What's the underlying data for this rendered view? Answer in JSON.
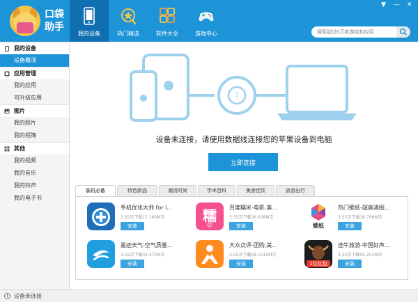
{
  "brand": {
    "line1": "口袋",
    "line2": "助手"
  },
  "nav": [
    {
      "label": "我的设备",
      "icon": "phone-icon"
    },
    {
      "label": "热门精选",
      "icon": "star-icon"
    },
    {
      "label": "软件大全",
      "icon": "apps-grid-icon"
    },
    {
      "label": "游戏中心",
      "icon": "gamepad-icon"
    }
  ],
  "window": {
    "menu": "▼",
    "minimize": "—",
    "close": "✕"
  },
  "search": {
    "placeholder": "搜索超过6万款游戏和应用"
  },
  "sidebar": [
    {
      "title": "我的设备",
      "icon": "device-icon",
      "items": [
        "设备概况"
      ]
    },
    {
      "title": "应用管理",
      "icon": "app-manage-icon",
      "items": [
        "我的应用",
        "可升级应用"
      ]
    },
    {
      "title": "图片",
      "icon": "image-icon",
      "items": [
        "我的照片",
        "我的相簿"
      ]
    },
    {
      "title": "其他",
      "icon": "grid-icon",
      "items": [
        "我的视频",
        "我的音乐",
        "我的铃声",
        "我的电子书"
      ]
    }
  ],
  "main": {
    "illus_mark": "?",
    "message": "设备未连接，请使用数据线连接您的苹果设备到电脑",
    "connect_button": "立即连接",
    "tabs": [
      "装机必备",
      "特色新品",
      "潮流时尚",
      "学术百科",
      "美食佳饮",
      "旅游出行"
    ],
    "apps": [
      {
        "name": "手机优化大师 for i...",
        "info": "3.55次下载17.180M次",
        "install": "安装"
      },
      {
        "name": "百度糯米-电影,美...",
        "info": "3.55次下载36.638M次",
        "install": "安装",
        "icon_text": "糯",
        "icon_sub": "☺"
      },
      {
        "name": "热门壁纸-超高清图...",
        "info": "3.55次下载38.796M次",
        "install": "安装",
        "icon_text": "壁纸"
      },
      {
        "name": "墨迹天气-空气质量...",
        "info": "3.55次下载34.372M次",
        "install": "安装"
      },
      {
        "name": "大众点评-团购,美...",
        "info": "3.55次下载58.1010M次",
        "install": "安装"
      },
      {
        "name": "途牛旅游-中国好声...",
        "info": "3.55次下载59.253M次",
        "install": "安装",
        "icon_text": "1亿红包"
      }
    ]
  },
  "status": {
    "icon_text": "i",
    "text": "设备未连接"
  },
  "colors": {
    "accent": "#1d94d8",
    "accent_dark": "#0f6fb0",
    "illustration": "#9ed1ee"
  }
}
